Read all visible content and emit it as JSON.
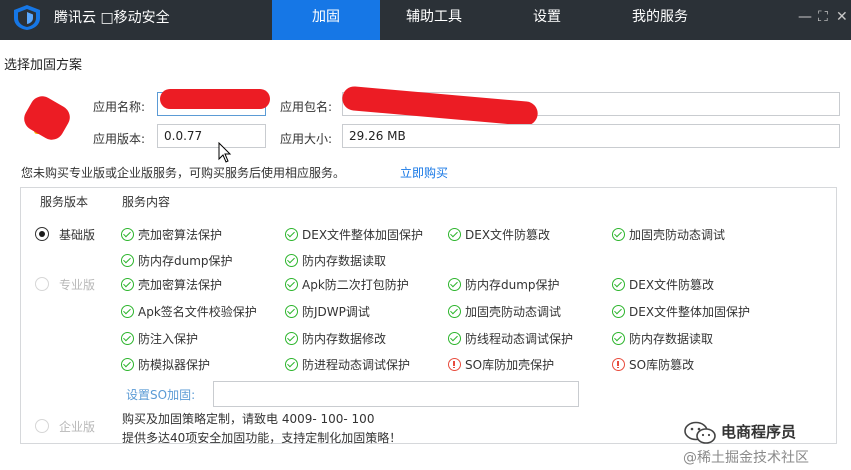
{
  "window": {
    "brand": "腾讯云 □移动安全",
    "nav_tabs": [
      "加固",
      "辅助工具",
      "设置",
      "我的服务"
    ],
    "active_tab": "加固",
    "controls": {
      "minimize": "—",
      "maximize": "⛶",
      "close": "✕"
    }
  },
  "section_title": "选择加固方案",
  "app_info": {
    "name_label": "应用名称:",
    "package_label": "应用包名:",
    "version_label": "应用版本:",
    "version_value": "0.0.77",
    "size_label": "应用大小:",
    "size_value": "29.26 MB"
  },
  "notice": {
    "text": "您未购买专业版或企业版服务，可购买服务后使用相应服务。",
    "link": "立即购买"
  },
  "services": {
    "col_version": "服务版本",
    "col_content": "服务内容",
    "tiers": {
      "basic": {
        "name": "基础版",
        "selected": true,
        "features": [
          "壳加密算法保护",
          "DEX文件整体加固保护",
          "DEX文件防篡改",
          "加固壳防动态调试",
          "防内存dump保护",
          "防内存数据读取"
        ]
      },
      "pro": {
        "name": "专业版",
        "selected": false,
        "features": [
          "壳加密算法保护",
          "Apk防二次打包防护",
          "防内存dump保护",
          "DEX文件防篡改",
          "Apk签名文件校验保护",
          "防JDWP调试",
          "加固壳防动态调试",
          "DEX文件整体加固保护",
          "防注入保护",
          "防内存数据修改",
          "防线程动态调试保护",
          "防内存数据读取",
          "防模拟器保护",
          "防进程动态调试保护",
          "SO库防加壳保护",
          "SO库防篡改"
        ],
        "warn_features": [
          "SO库防加壳保护",
          "SO库防篡改"
        ],
        "so_label": "设置SO加固:"
      },
      "enterprise": {
        "name": "企业版",
        "selected": false,
        "line1": "购买及加固策略定制，请致电 4009- 100- 100",
        "line2": "提供多达40项安全加固功能，支持定制化加固策略！"
      }
    }
  },
  "watermark": {
    "title": "电商程序员",
    "sub": "@稀土掘金技术社区"
  },
  "colors": {
    "titlebar": "#2b3137",
    "active_tab": "#1677e6",
    "link": "#1677e6",
    "check": "#2db52d",
    "warn": "#e84c3d",
    "redaction": "#ec1c24"
  }
}
